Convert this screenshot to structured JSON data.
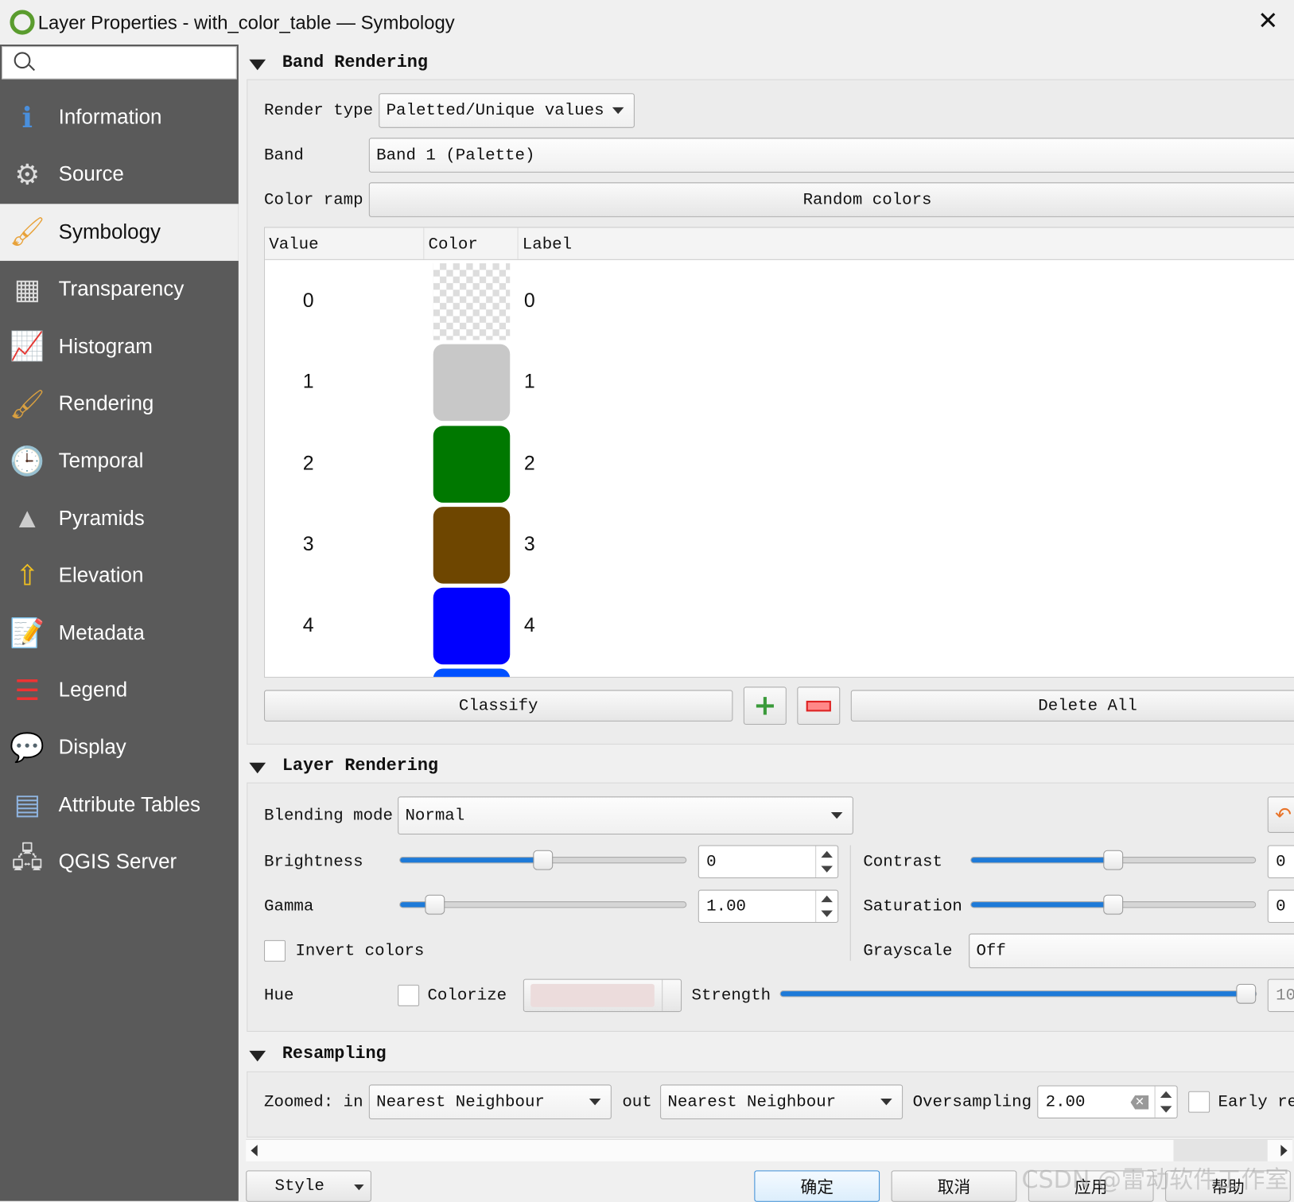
{
  "window": {
    "title": "Layer Properties - with_color_table — Symbology",
    "close_icon": "close-icon",
    "app_icon": "qgis-logo"
  },
  "sidebar": {
    "search_placeholder": "",
    "items": [
      {
        "label": "Information",
        "icon": "info-icon"
      },
      {
        "label": "Source",
        "icon": "source-icon"
      },
      {
        "label": "Symbology",
        "icon": "symbology-icon",
        "selected": true
      },
      {
        "label": "Transparency",
        "icon": "transparency-icon"
      },
      {
        "label": "Histogram",
        "icon": "histogram-icon"
      },
      {
        "label": "Rendering",
        "icon": "rendering-icon"
      },
      {
        "label": "Temporal",
        "icon": "clock-icon"
      },
      {
        "label": "Pyramids",
        "icon": "pyramids-icon"
      },
      {
        "label": "Elevation",
        "icon": "elevation-icon"
      },
      {
        "label": "Metadata",
        "icon": "metadata-icon"
      },
      {
        "label": "Legend",
        "icon": "legend-icon"
      },
      {
        "label": "Display",
        "icon": "display-icon"
      },
      {
        "label": "Attribute Tables",
        "icon": "table-icon"
      },
      {
        "label": "QGIS Server",
        "icon": "server-icon"
      }
    ]
  },
  "band_rendering": {
    "title": "Band Rendering",
    "render_type_label": "Render type",
    "render_type": "Paletted/Unique values",
    "band_label": "Band",
    "band": "Band 1 (Palette)",
    "color_ramp_label": "Color ramp",
    "color_ramp": "Random colors",
    "table": {
      "headers": [
        "Value",
        "Color",
        "Label"
      ],
      "rows": [
        {
          "value": "0",
          "color": "transparent",
          "label": "0"
        },
        {
          "value": "1",
          "color": "#c8c8c8",
          "label": "1"
        },
        {
          "value": "2",
          "color": "#007800",
          "label": "2"
        },
        {
          "value": "3",
          "color": "#6e4600",
          "label": "3"
        },
        {
          "value": "4",
          "color": "#0000ff",
          "label": "4"
        }
      ]
    },
    "classify": "Classify",
    "delete_all": "Delete All"
  },
  "layer_rendering": {
    "title": "Layer Rendering",
    "blending_label": "Blending mode",
    "blending": "Normal",
    "brightness_label": "Brightness",
    "brightness": "0",
    "brightness_pct": 50,
    "contrast_label": "Contrast",
    "contrast": "0",
    "contrast_pct": 50,
    "gamma_label": "Gamma",
    "gamma": "1.00",
    "gamma_pct": 12,
    "saturation_label": "Saturation",
    "saturation": "0",
    "saturation_pct": 50,
    "invert_label": "Invert colors",
    "invert": false,
    "grayscale_label": "Grayscale",
    "grayscale": "Off",
    "hue_label": "Hue",
    "colorize_label": "Colorize",
    "colorize": false,
    "colorize_color": "#ecdcdc",
    "strength_label": "Strength",
    "strength": "10",
    "strength_pct": 100
  },
  "resampling": {
    "title": "Resampling",
    "zoomed_in_label": "Zoomed: in",
    "zoomed_in": "Nearest Neighbour",
    "out_label": "out",
    "zoomed_out": "Nearest Neighbour",
    "oversampling_label": "Oversampling",
    "oversampling": "2.00",
    "early_label": "Early re"
  },
  "footer": {
    "style": "Style",
    "ok": "确定",
    "cancel": "取消",
    "apply": "应用",
    "help": "帮助",
    "watermark": "CSDN @雷动软件工作室"
  }
}
